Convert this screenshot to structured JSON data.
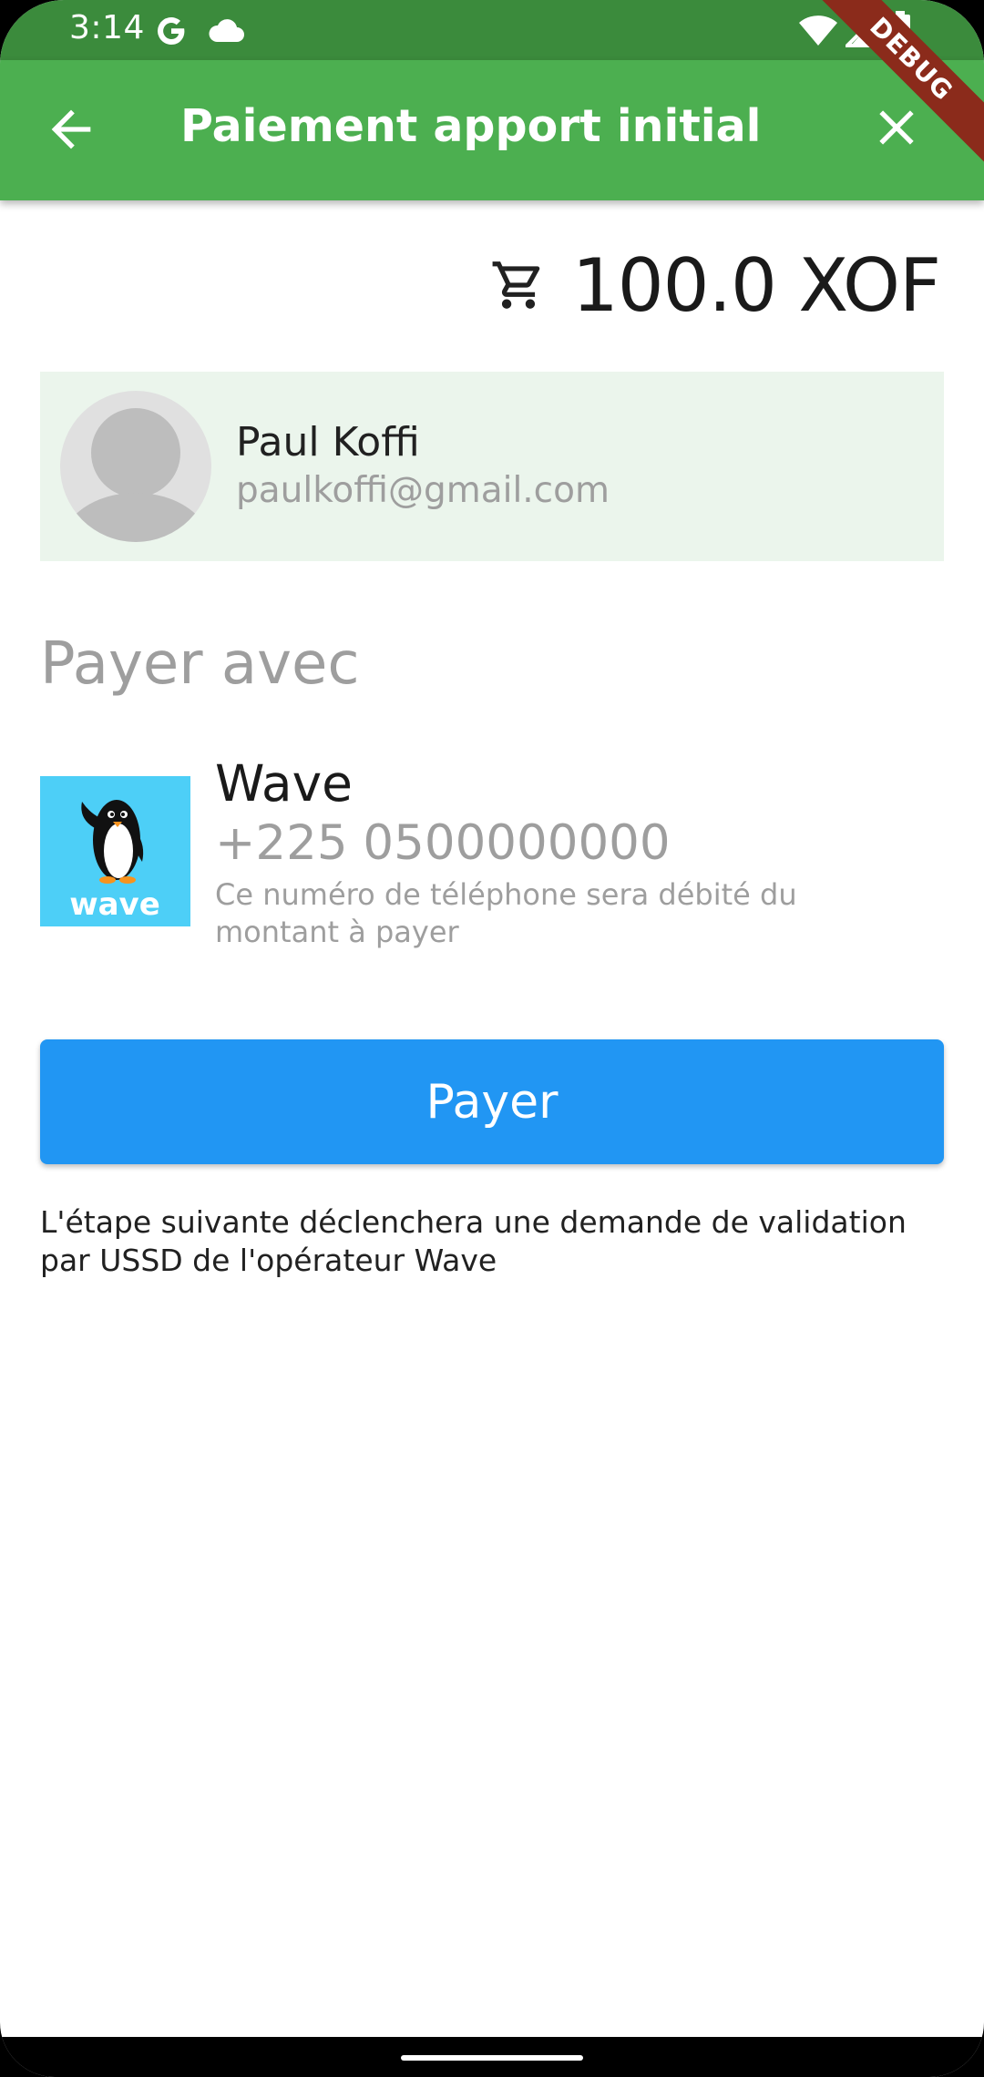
{
  "status_bar": {
    "time": "3:14",
    "icons": [
      "google-icon",
      "cloud-icon",
      "wifi-icon",
      "signal-icon",
      "battery-icon"
    ]
  },
  "app_bar": {
    "title": "Paiement apport initial",
    "debug_banner": "DEBUG",
    "color": "#4caf50"
  },
  "amount": {
    "value": "100.0 XOF",
    "icon": "cart-icon"
  },
  "user": {
    "name": "Paul Koffi",
    "email": "paulkoffi@gmail.com"
  },
  "payment": {
    "heading": "Payer avec",
    "method_name": "Wave",
    "logo_text": "wave",
    "phone": "+225 0500000000",
    "note": "Ce numéro de téléphone sera débité du montant à payer"
  },
  "pay_button": {
    "label": "Payer",
    "color": "#2196f3"
  },
  "info": {
    "text": "L'étape suivante déclenchera une demande de validation par USSD de l'opérateur Wave"
  }
}
